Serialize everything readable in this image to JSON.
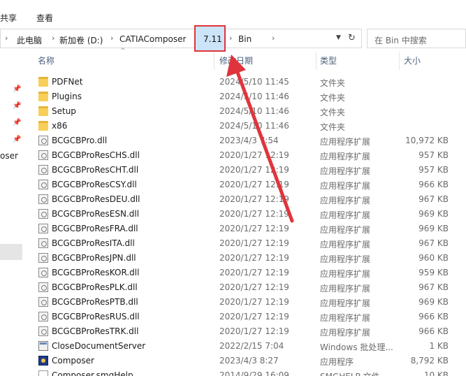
{
  "ribbon": {
    "share": "共享",
    "view": "查看"
  },
  "address": {
    "crumbs": [
      "此电脑",
      "新加卷 (D:)",
      "CATIAComposer",
      "7.11",
      "Bin"
    ],
    "highlight_color": "#e0343c"
  },
  "search": {
    "placeholder": "在 Bin 中搜索"
  },
  "nav": {
    "partial_label": "oser"
  },
  "columns": {
    "name": "名称",
    "date": "修改日期",
    "type": "类型",
    "size": "大小"
  },
  "files": [
    {
      "icon": "folder-icon",
      "name": "PDFNet",
      "date": "2024/5/10 11:45",
      "type": "文件夹",
      "size": ""
    },
    {
      "icon": "folder-icon",
      "name": "Plugins",
      "date": "2024/5/10 11:46",
      "type": "文件夹",
      "size": ""
    },
    {
      "icon": "folder-icon",
      "name": "Setup",
      "date": "2024/5/10 11:46",
      "type": "文件夹",
      "size": ""
    },
    {
      "icon": "folder-icon",
      "name": "x86",
      "date": "2024/5/10 11:46",
      "type": "文件夹",
      "size": ""
    },
    {
      "icon": "dll-icon",
      "name": "BCGCBPro.dll",
      "date": "2023/4/3 7:54",
      "type": "应用程序扩展",
      "size": "10,972 KB"
    },
    {
      "icon": "dll-icon",
      "name": "BCGCBProResCHS.dll",
      "date": "2020/1/27 12:19",
      "type": "应用程序扩展",
      "size": "957 KB"
    },
    {
      "icon": "dll-icon",
      "name": "BCGCBProResCHT.dll",
      "date": "2020/1/27 12:19",
      "type": "应用程序扩展",
      "size": "957 KB"
    },
    {
      "icon": "dll-icon",
      "name": "BCGCBProResCSY.dll",
      "date": "2020/1/27 12:19",
      "type": "应用程序扩展",
      "size": "966 KB"
    },
    {
      "icon": "dll-icon",
      "name": "BCGCBProResDEU.dll",
      "date": "2020/1/27 12:19",
      "type": "应用程序扩展",
      "size": "967 KB"
    },
    {
      "icon": "dll-icon",
      "name": "BCGCBProResESN.dll",
      "date": "2020/1/27 12:19",
      "type": "应用程序扩展",
      "size": "969 KB"
    },
    {
      "icon": "dll-icon",
      "name": "BCGCBProResFRA.dll",
      "date": "2020/1/27 12:19",
      "type": "应用程序扩展",
      "size": "969 KB"
    },
    {
      "icon": "dll-icon",
      "name": "BCGCBProResITA.dll",
      "date": "2020/1/27 12:19",
      "type": "应用程序扩展",
      "size": "967 KB"
    },
    {
      "icon": "dll-icon",
      "name": "BCGCBProResJPN.dll",
      "date": "2020/1/27 12:19",
      "type": "应用程序扩展",
      "size": "960 KB"
    },
    {
      "icon": "dll-icon",
      "name": "BCGCBProResKOR.dll",
      "date": "2020/1/27 12:19",
      "type": "应用程序扩展",
      "size": "959 KB"
    },
    {
      "icon": "dll-icon",
      "name": "BCGCBProResPLK.dll",
      "date": "2020/1/27 12:19",
      "type": "应用程序扩展",
      "size": "967 KB"
    },
    {
      "icon": "dll-icon",
      "name": "BCGCBProResPTB.dll",
      "date": "2020/1/27 12:19",
      "type": "应用程序扩展",
      "size": "969 KB"
    },
    {
      "icon": "dll-icon",
      "name": "BCGCBProResRUS.dll",
      "date": "2020/1/27 12:19",
      "type": "应用程序扩展",
      "size": "966 KB"
    },
    {
      "icon": "dll-icon",
      "name": "BCGCBProResTRK.dll",
      "date": "2020/1/27 12:19",
      "type": "应用程序扩展",
      "size": "966 KB"
    },
    {
      "icon": "exe-icon",
      "name": "CloseDocumentServer",
      "date": "2022/2/15 7:04",
      "type": "Windows 批处理...",
      "size": "1 KB"
    },
    {
      "icon": "composer-app-icon",
      "name": "Composer",
      "date": "2023/4/3 8:27",
      "type": "应用程序",
      "size": "8,792 KB"
    },
    {
      "icon": "chm-icon",
      "name": "Composer.smgHelp",
      "date": "2014/9/29 16:09",
      "type": "SMGHELP 文件",
      "size": "10 KB"
    }
  ]
}
